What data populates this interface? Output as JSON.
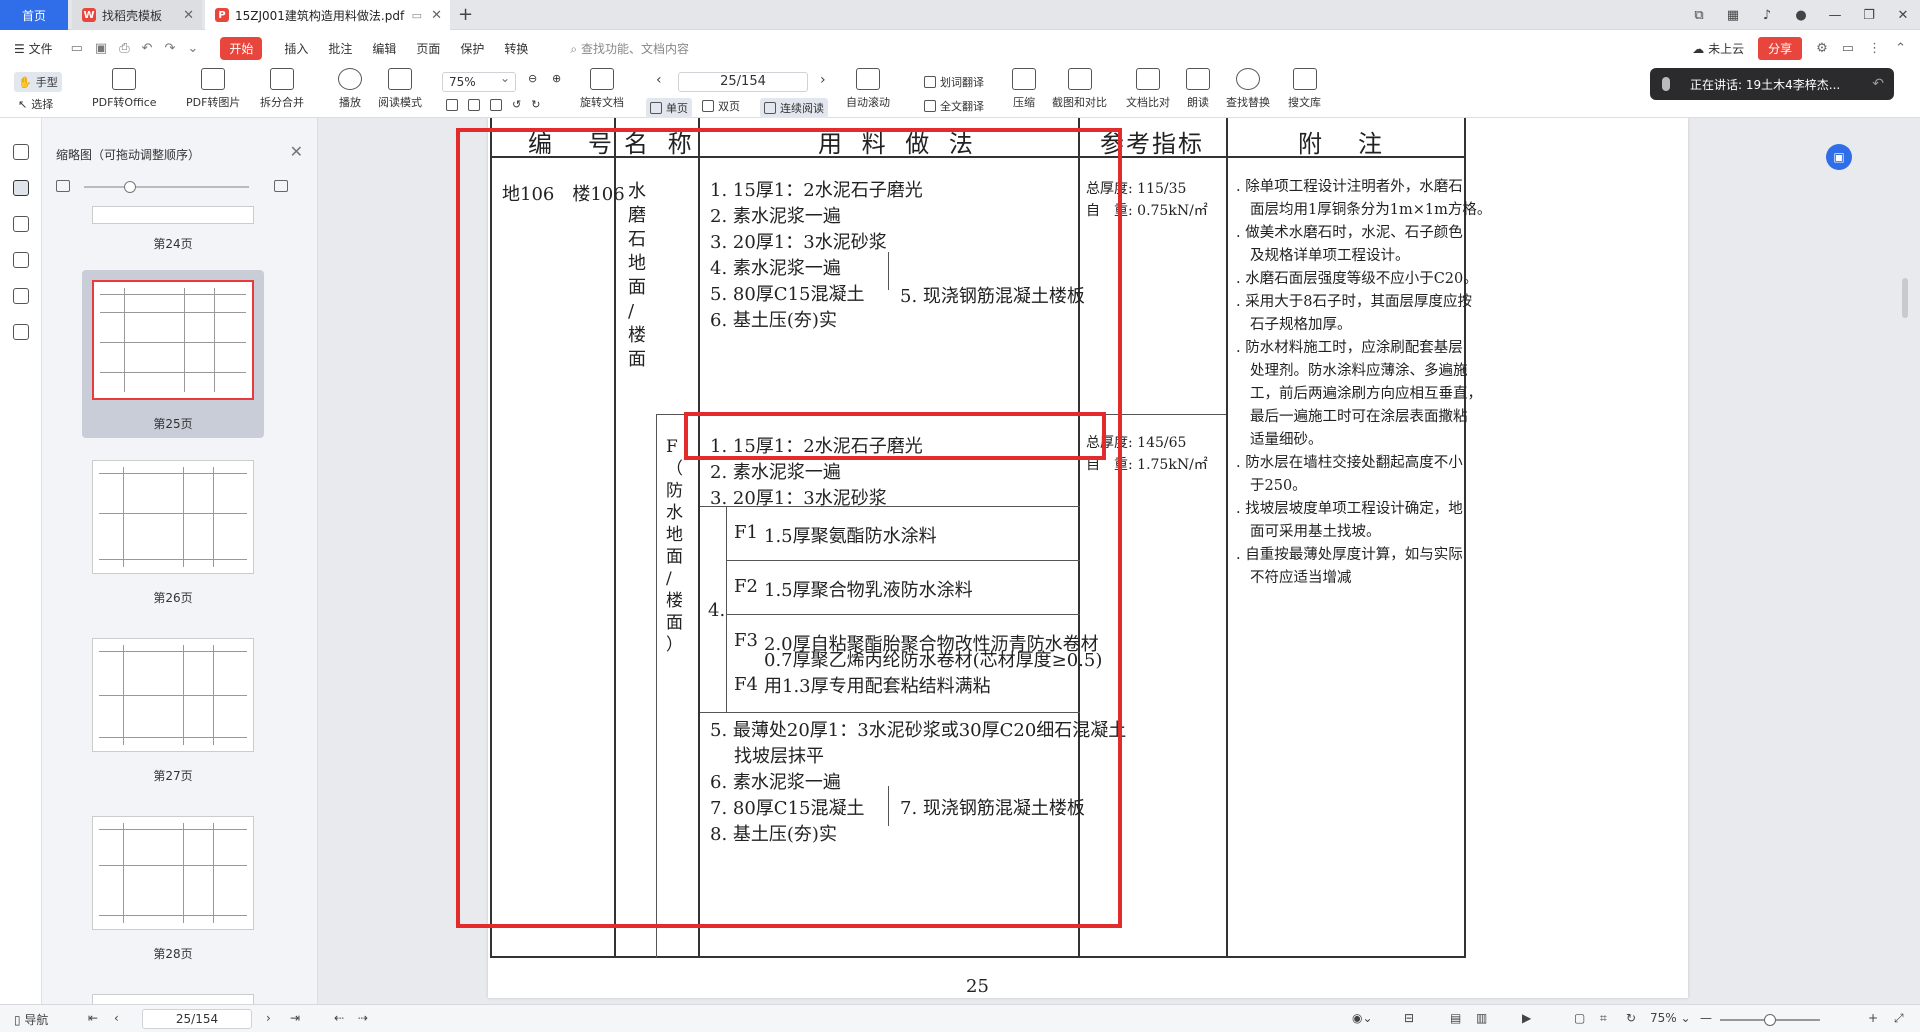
{
  "tabs": {
    "home": "首页",
    "template": "找稻壳模板",
    "doc": "15ZJ001建筑构造用料做法.pdf",
    "add": "+"
  },
  "menu": {
    "file": "文件",
    "start": "开始",
    "items": [
      "插入",
      "批注",
      "编辑",
      "页面",
      "保护",
      "转换"
    ],
    "search": "查找功能、文档内容",
    "cloud": "未上云",
    "share": "分享"
  },
  "toolbar": {
    "hand": "手型",
    "select": "选择",
    "pdf_office": "PDF转Office",
    "pdf_image": "PDF转图片",
    "split_merge": "拆分合并",
    "play": "播放",
    "read_mode": "阅读模式",
    "zoom": "75%",
    "page": "25/154",
    "rotate": "旋转文档",
    "single": "单页",
    "double": "双页",
    "continuous": "连续阅读",
    "auto_scroll": "自动滚动",
    "word_translate": "划词翻译",
    "full_translate": "全文翻译",
    "compress": "压缩",
    "screenshot": "截图和对比",
    "compare": "文档比对",
    "read_aloud": "朗读",
    "find_replace": "查找替换",
    "search_lib": "搜文库"
  },
  "voice": {
    "text": "正在讲话: 19土木4李梓杰..."
  },
  "thumbnails": {
    "title": "缩略图（可拖动调整顺序）",
    "pages": [
      "第24页",
      "第25页",
      "第26页",
      "第27页",
      "第28页"
    ]
  },
  "doc": {
    "headers": {
      "code": "编　号",
      "name": "名 称",
      "method": "用 料 做 法",
      "ref": "参考指标",
      "note": "附　注"
    },
    "code": "地106　楼106",
    "name_chars": [
      "水",
      "磨",
      "石",
      "地",
      "面",
      "/",
      "楼",
      "面"
    ],
    "upper_steps": [
      "1. 15厚1：2水泥石子磨光",
      "2. 素水泥浆一遍",
      "3. 20厚1：3水泥砂浆",
      "4. 素水泥浆一遍",
      "5. 80厚C15混凝土",
      "6. 基土压(夯)实"
    ],
    "upper_alt": "5. 现浇钢筋混凝土楼板",
    "upper_ref1": "总厚度: 115/35",
    "upper_ref2": "自　重: 0.75kN/㎡",
    "f_label_chars": [
      "F",
      "（",
      "防",
      "水",
      "地",
      "面",
      "/",
      "楼",
      "面",
      "）"
    ],
    "lower_steps": [
      "1. 15厚1：2水泥石子磨光",
      "2. 素水泥浆一遍",
      "3. 20厚1：3水泥砂浆"
    ],
    "step4_num": "4.",
    "options": [
      {
        "code": "F1",
        "text": "1.5厚聚氨酯防水涂料"
      },
      {
        "code": "F2",
        "text": "1.5厚聚合物乳液防水涂料"
      },
      {
        "code": "F3",
        "text": "2.0厚自粘聚酯胎聚合物改性沥青防水卷材"
      },
      {
        "code": "F4",
        "text": "0.7厚聚乙烯丙纶防水卷材(芯材厚度≥0.5)",
        "text2": "用1.3厚专用配套粘结料满粘"
      }
    ],
    "lower_steps2": [
      "5. 最薄处20厚1：3水泥砂浆或30厚C20细石混凝土",
      "找坡层抹平",
      "6. 素水泥浆一遍",
      "7. 80厚C15混凝土",
      "8. 基土压(夯)实"
    ],
    "lower_alt": "7. 现浇钢筋混凝土楼板",
    "lower_ref1": "总厚度: 145/65",
    "lower_ref2": "自　重: 1.75kN/㎡",
    "notes": [
      ". 除单项工程设计注明者外，水磨石",
      "面层均用1厚铜条分为1m×1m方格。",
      ". 做美术水磨石时，水泥、石子颜色",
      "及规格详单项工程设计。",
      ". 水磨石面层强度等级不应小于C20。",
      ". 采用大于8石子时，其面层厚度应按",
      "石子规格加厚。",
      ". 防水材料施工时，应涂刷配套基层",
      "处理剂。防水涂料应薄涂、多遍施",
      "工，前后两遍涂刷方向应相互垂直，",
      "最后一遍施工时可在涂层表面撒粘",
      "适量细砂。",
      ". 防水层在墙柱交接处翻起高度不小",
      "于250。",
      ". 找坡层坡度单项工程设计确定，地",
      "面可采用基土找坡。",
      ". 自重按最薄处厚度计算，如与实际",
      "不符应适当增减"
    ],
    "page_number": "25"
  },
  "status": {
    "nav": "导航",
    "page": "25/154",
    "zoom": "75%"
  }
}
